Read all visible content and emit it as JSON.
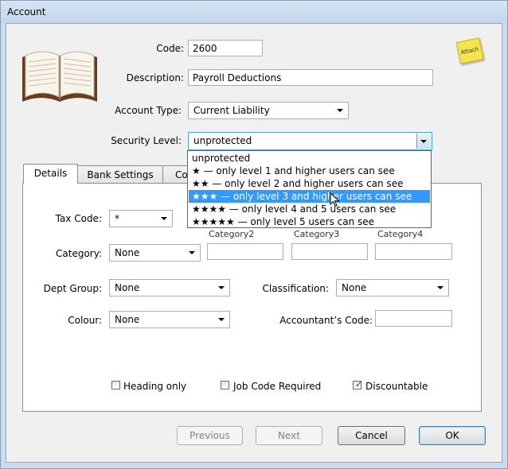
{
  "window": {
    "title": "Account"
  },
  "form": {
    "code_label": "Code:",
    "code_value": "2600",
    "description_label": "Description:",
    "description_value": "Payroll Deductions",
    "account_type_label": "Account Type:",
    "account_type_value": "Current Liability",
    "security_level_label": "Security Level:",
    "security_level_value": "unprotected"
  },
  "note_icon": {
    "text": "Attach"
  },
  "security_options": [
    {
      "stars": "",
      "text": "unprotected"
    },
    {
      "stars": "★",
      "text": " — only level 1 and higher users can see"
    },
    {
      "stars": "★★",
      "text": " — only level 2 and higher users can see"
    },
    {
      "stars": "★★★",
      "text": " — only level 3 and higher users can see"
    },
    {
      "stars": "★★★★",
      "text": " — only level 4 and 5 users can see"
    },
    {
      "stars": "★★★★★",
      "text": " — only level 5 users can see"
    }
  ],
  "selected_option_index": 3,
  "tabs": [
    {
      "label": "Details",
      "active": true
    },
    {
      "label": "Bank Settings",
      "active": false
    },
    {
      "label": "Co",
      "active": false
    }
  ],
  "details": {
    "tax_code_label": "Tax Code:",
    "tax_code_value": "*",
    "category_label": "Category:",
    "category_value": "None",
    "category2_label": "Category2",
    "category3_label": "Category3",
    "category4_label": "Category4",
    "dept_group_label": "Dept Group:",
    "dept_group_value": "None",
    "classification_label": "Classification:",
    "classification_value": "None",
    "colour_label": "Colour:",
    "colour_value": "None",
    "accountants_code_label": "Accountant’s Code:",
    "heading_only_label": "Heading only",
    "heading_only_checked": false,
    "job_code_required_label": "Job Code Required",
    "job_code_required_checked": false,
    "discountable_label": "Discountable",
    "discountable_checked": true
  },
  "buttons": {
    "previous": "Previous",
    "next": "Next",
    "cancel": "Cancel",
    "ok": "OK"
  },
  "colors": {
    "selection": "#3399ff",
    "sticky_note": "#f4e54c"
  }
}
